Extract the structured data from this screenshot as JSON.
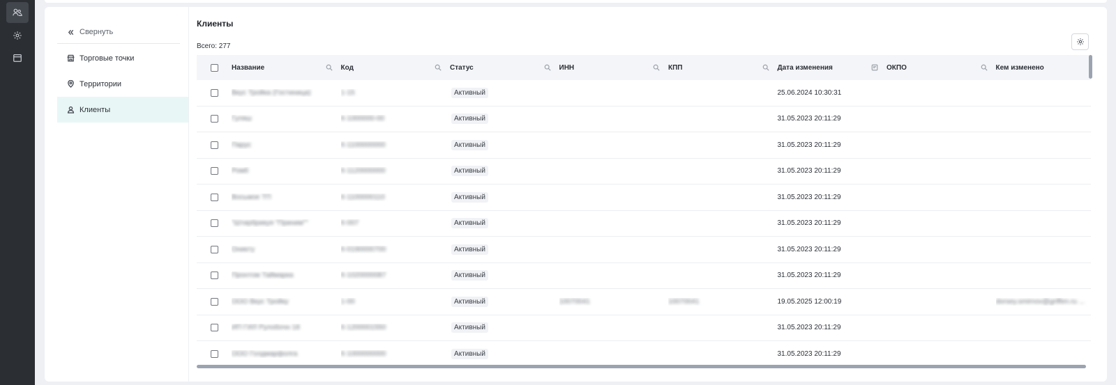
{
  "sidebar_nav": {
    "collapse_label": "Свернуть",
    "items": [
      {
        "label": "Торговые точки",
        "icon": "store-icon"
      },
      {
        "label": "Территории",
        "icon": "map-pin-icon"
      },
      {
        "label": "Клиенты",
        "icon": "user-icon",
        "active": true
      }
    ]
  },
  "page": {
    "title": "Клиенты",
    "total": "Всего: 277"
  },
  "table": {
    "columns": [
      "Название",
      "Код",
      "Статус",
      "ИНН",
      "КПП",
      "Дата изменения",
      "ОКПО",
      "Кем изменено"
    ],
    "rows": [
      {
        "name": "Вкус Тройка (Гостиница)",
        "code": "1-15",
        "status": "Активный",
        "inn": "",
        "kpp": "",
        "date": "25.06.2024 10:30:31",
        "okpo": "",
        "by": ""
      },
      {
        "name": "Гуляш",
        "code": "К-1000000-00",
        "status": "Активный",
        "inn": "",
        "kpp": "",
        "date": "31.05.2023 20:11:29",
        "okpo": "",
        "by": ""
      },
      {
        "name": "Парус",
        "code": "К-1100000000",
        "status": "Активный",
        "inn": "",
        "kpp": "",
        "date": "31.05.2023 20:11:29",
        "okpo": "",
        "by": ""
      },
      {
        "name": "Ромб",
        "code": "К-1120000000",
        "status": "Активный",
        "inn": "",
        "kpp": "",
        "date": "31.05.2023 20:11:29",
        "okpo": "",
        "by": ""
      },
      {
        "name": "Восьмое ТП",
        "code": "К-1100000110",
        "status": "Активный",
        "inn": "",
        "kpp": "",
        "date": "31.05.2023 20:11:29",
        "okpo": "",
        "by": ""
      },
      {
        "name": "\"Штирбрикуя \"Приним\"\"",
        "code": "К-007",
        "status": "Активный",
        "inn": "",
        "kpp": "",
        "date": "31.05.2023 20:11:29",
        "okpo": "",
        "by": ""
      },
      {
        "name": "Оникту",
        "code": "К-0190000700",
        "status": "Активный",
        "inn": "",
        "kpp": "",
        "date": "31.05.2023 20:11:29",
        "okpo": "",
        "by": ""
      },
      {
        "name": "Пронтом Таймарка",
        "code": "К-1020000087",
        "status": "Активный",
        "inn": "",
        "kpp": "",
        "date": "31.05.2023 20:11:29",
        "okpo": "",
        "by": ""
      },
      {
        "name": "ООО Вкус Тройку",
        "code": "1-00",
        "status": "Активный",
        "inn": "10070041",
        "kpp": "10070041",
        "date": "19.05.2025 12:00:19",
        "okpo": "",
        "by": "dorsey.smirnov@griffen.ru ..."
      },
      {
        "name": "ИП ГИЛ Рулобочн 18",
        "code": "К-1200001550",
        "status": "Активный",
        "inn": "",
        "kpp": "",
        "date": "31.05.2023 20:11:29",
        "okpo": "",
        "by": ""
      },
      {
        "name": "ООО Голдмарфолга",
        "code": "К-1000000000",
        "status": "Активный",
        "inn": "",
        "kpp": "",
        "date": "31.05.2023 20:11:29",
        "okpo": "",
        "by": ""
      }
    ]
  },
  "colors": {
    "rail": "#2b2e33",
    "active_nav": "#e8f6f6",
    "header_bg": "#f4f5f8",
    "scrollbar": "#9ca3b0"
  }
}
